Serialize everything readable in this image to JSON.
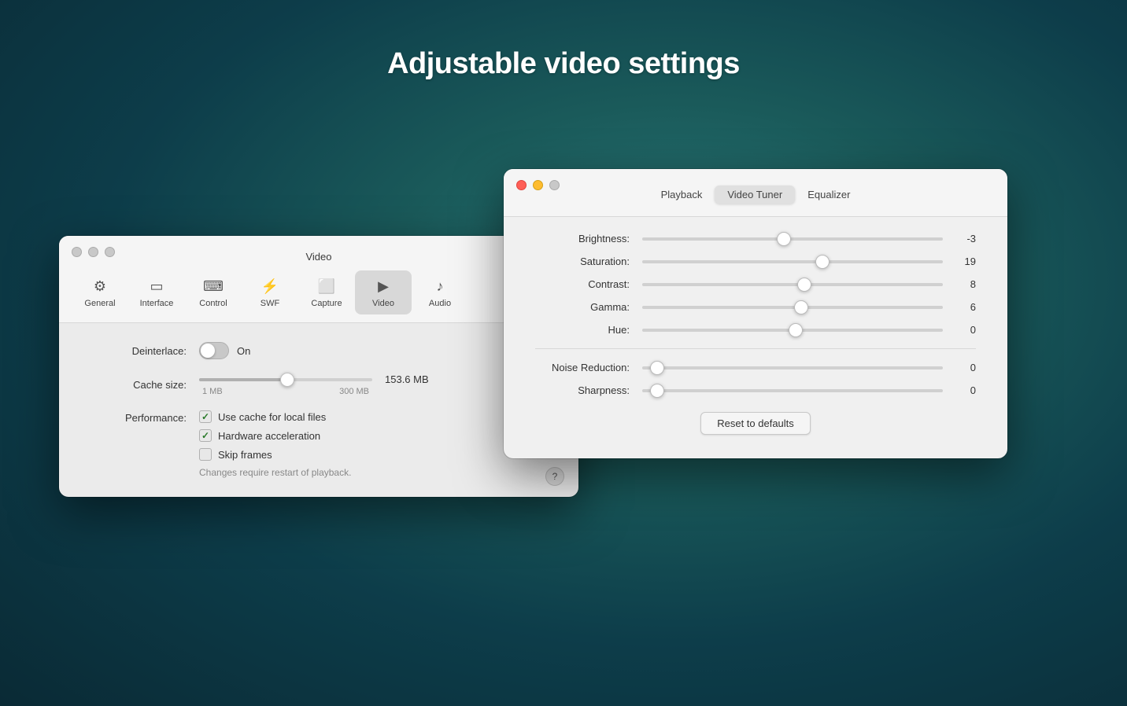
{
  "page": {
    "title": "Adjustable video settings",
    "background": "teal gradient"
  },
  "video_window": {
    "title": "Video",
    "toolbar_items": [
      {
        "id": "general",
        "label": "General",
        "icon": "⚙"
      },
      {
        "id": "interface",
        "label": "Interface",
        "icon": "▭"
      },
      {
        "id": "control",
        "label": "Control",
        "icon": "⌨"
      },
      {
        "id": "swf",
        "label": "SWF",
        "icon": "⚡"
      },
      {
        "id": "capture",
        "label": "Capture",
        "icon": "📷"
      },
      {
        "id": "video",
        "label": "Video",
        "icon": "▶",
        "active": true
      },
      {
        "id": "audio",
        "label": "Audio",
        "icon": "♪"
      }
    ],
    "deinterlace_label": "Deinterlace:",
    "deinterlace_state": "On",
    "cache_size_label": "Cache size:",
    "cache_size_value": "153.6 MB",
    "cache_min": "1 MB",
    "cache_max": "300 MB",
    "cache_slider_percent": 51,
    "performance_label": "Performance:",
    "checkboxes": [
      {
        "id": "use_cache",
        "label": "Use cache for local files",
        "checked": true
      },
      {
        "id": "hw_accel",
        "label": "Hardware acceleration",
        "checked": true
      },
      {
        "id": "skip_frames",
        "label": "Skip frames",
        "checked": false
      }
    ],
    "restart_note": "Changes require restart of playback.",
    "help_label": "?"
  },
  "tuner_window": {
    "tabs": [
      {
        "id": "playback",
        "label": "Playback",
        "active": false
      },
      {
        "id": "video_tuner",
        "label": "Video Tuner",
        "active": true
      },
      {
        "id": "equalizer",
        "label": "Equalizer",
        "active": false
      }
    ],
    "sliders_main": [
      {
        "id": "brightness",
        "label": "Brightness:",
        "value": -3,
        "percent": 47
      },
      {
        "id": "saturation",
        "label": "Saturation:",
        "value": 19,
        "percent": 60
      },
      {
        "id": "contrast",
        "label": "Contrast:",
        "value": 8,
        "percent": 54
      },
      {
        "id": "gamma",
        "label": "Gamma:",
        "value": 6,
        "percent": 53
      },
      {
        "id": "hue",
        "label": "Hue:",
        "value": 0,
        "percent": 51
      }
    ],
    "sliders_secondary": [
      {
        "id": "noise_reduction",
        "label": "Noise Reduction:",
        "value": 0,
        "percent": 5
      },
      {
        "id": "sharpness",
        "label": "Sharpness:",
        "value": 0,
        "percent": 5
      }
    ],
    "reset_button_label": "Reset to defaults"
  }
}
